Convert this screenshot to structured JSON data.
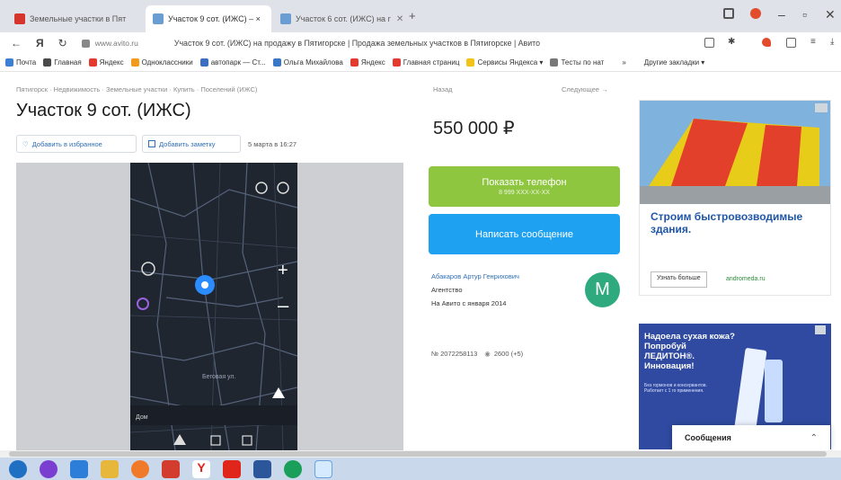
{
  "browser": {
    "tabs": [
      {
        "label": "Земельные участки в Пят",
        "active": false,
        "favicon_color": "#d6352e"
      },
      {
        "label": "Участок 9 сот. (ИЖС) – ×",
        "active": true,
        "favicon_color": "#6a9ed3"
      },
      {
        "label": "Участок 6 сот. (ИЖС) на г",
        "active": false,
        "favicon_color": "#6a9ed3"
      }
    ],
    "new_tab": "+",
    "url": "www.avito.ru",
    "page_title": "Участок 9 сот. (ИЖС) на продажу в Пятигорске | Продажа земельных участков в Пятигорске | Авито",
    "bookmarks": [
      {
        "label": "Почта",
        "icon_color": "#3d7fd6"
      },
      {
        "label": "Главная",
        "icon_color": "#4a4a4a"
      },
      {
        "label": "Яндекс",
        "icon_color": "#e33a2d"
      },
      {
        "label": "Одноклассники",
        "icon_color": "#f29a1a"
      },
      {
        "label": "автопарк — Ст...",
        "icon_color": "#3b6fc4"
      },
      {
        "label": "Ольга Михайлова",
        "icon_color": "#3a78c7"
      },
      {
        "label": "Яндекс",
        "icon_color": "#e33a2d"
      },
      {
        "label": "Главная страниц",
        "icon_color": "#e33a2d"
      },
      {
        "label": "Сервисы Яндекса ▾",
        "icon_color": "#f2c318"
      },
      {
        "label": "Тесты по нат",
        "icon_color": "#777777"
      },
      {
        "label": "»",
        "icon_color": "#ffffff"
      },
      {
        "label": "Другие закладки ▾",
        "icon_color": "#ffffff"
      }
    ]
  },
  "page": {
    "breadcrumb": "Пятигорск · Недвижимость · Земельные участки · Купить · Поселений (ИЖС)",
    "title": "Участок 9 сот. (ИЖС)",
    "add_favorite": "Добавить в избранное",
    "add_note": "Добавить заметку",
    "date": "5 марта в 16:27",
    "price_label": "Назад",
    "next_label": "Следующее →",
    "price": "550 000 ₽",
    "show_phone": "Показать телефон",
    "phone_mask": "8 999 XXX-XX-XX",
    "write_message": "Написать сообщение",
    "seller_name": "Абакаров Артур Генрихович",
    "seller_type": "Агентство",
    "seller_since": "На Авито с января 2014",
    "avatar_letter": "М",
    "ad_number": "№ 2072258113",
    "views": "2600 (+5)",
    "map_labels": {
      "street": "Беговая ул.",
      "status": "Дом"
    }
  },
  "ads": {
    "ad1_title": "Строим быстровозводимые здания.",
    "ad1_button": "Узнать больше",
    "ad1_site": "andromeda.ru",
    "ad2_title": "Надоела сухая кожа? Попробуй ЛЕДИТОН®. Инновация!",
    "ad2_text": "Без гормонов и консервантов. Работает с 1 го применения."
  },
  "messages": {
    "label": "Сообщения"
  }
}
